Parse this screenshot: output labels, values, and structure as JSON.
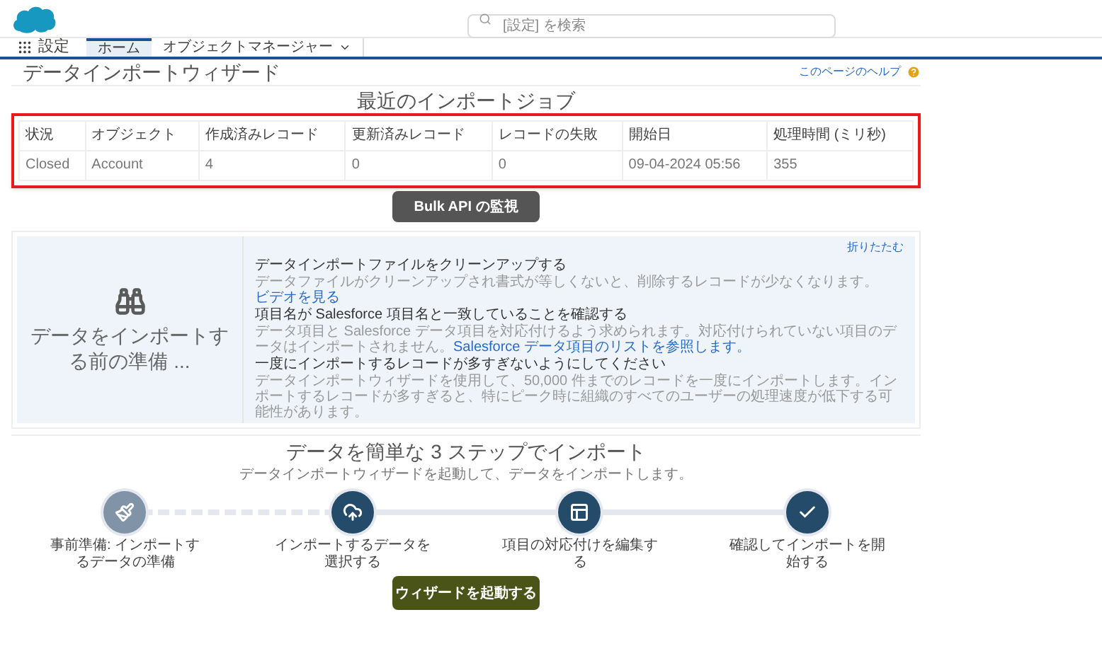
{
  "header": {
    "search": {
      "placeholder": "[設定] を検索"
    }
  },
  "nav": {
    "app_name": "設定",
    "tabs": [
      {
        "label": "ホーム",
        "selected": true,
        "dropdown": false
      },
      {
        "label": "オブジェクトマネージャー",
        "selected": false,
        "dropdown": true
      }
    ]
  },
  "page": {
    "title": "データインポートウィザード",
    "help_link": "このページのヘルプ"
  },
  "recent_jobs": {
    "title": "最近のインポートジョブ",
    "highlighted": true,
    "columns": [
      "状況",
      "オブジェクト",
      "作成済みレコード",
      "更新済みレコード",
      "レコードの失敗",
      "開始日",
      "処理時間 (ミリ秒)"
    ],
    "rows": [
      [
        "Closed",
        "Account",
        "4",
        "0",
        "0",
        "09-04-2024 05:56",
        "355"
      ]
    ],
    "button": "Bulk API の監視"
  },
  "prepare": {
    "title": "データをインポートする前の準備 ...",
    "collapse_link": "折りたたむ",
    "tips": [
      {
        "title": "データインポートファイルをクリーンアップする",
        "body": "データファイルがクリーンアップされ書式が等しくないと、削除するレコードが少なくなります。",
        "link": "ビデオを見る"
      },
      {
        "title": "項目名が Salesforce 項目名と一致していることを確認する",
        "body": "データ項目と Salesforce データ項目を対応付けるよう求められます。対応付けられていない項目のデータはインポートされません。",
        "link": "Salesforce データ項目のリストを参照します。"
      },
      {
        "title": "一度にインポートするレコードが多すぎないようにしてください",
        "body": "データインポートウィザードを使用して、50,000 件までのレコードを一度にインポートします。インポートするレコードが多すぎると、特にピーク時に組織のすべてのユーザーの処理速度が低下する可能性があります。"
      }
    ]
  },
  "steps_section": {
    "title": "データを簡単な 3 ステップでインポート",
    "subtitle": "データインポートウィザードを起動して、データをインポートします。",
    "steps": [
      {
        "kind": "broom",
        "label": "事前準備: インポートするデータの準備",
        "optional": true
      },
      {
        "kind": "upload",
        "label": "インポートするデータを選択する",
        "optional": false
      },
      {
        "kind": "layout",
        "label": "項目の対応付けを編集する",
        "optional": false
      },
      {
        "kind": "check",
        "label": "確認してインポートを開始する",
        "optional": false
      }
    ],
    "button": "ウィザードを起動する"
  }
}
